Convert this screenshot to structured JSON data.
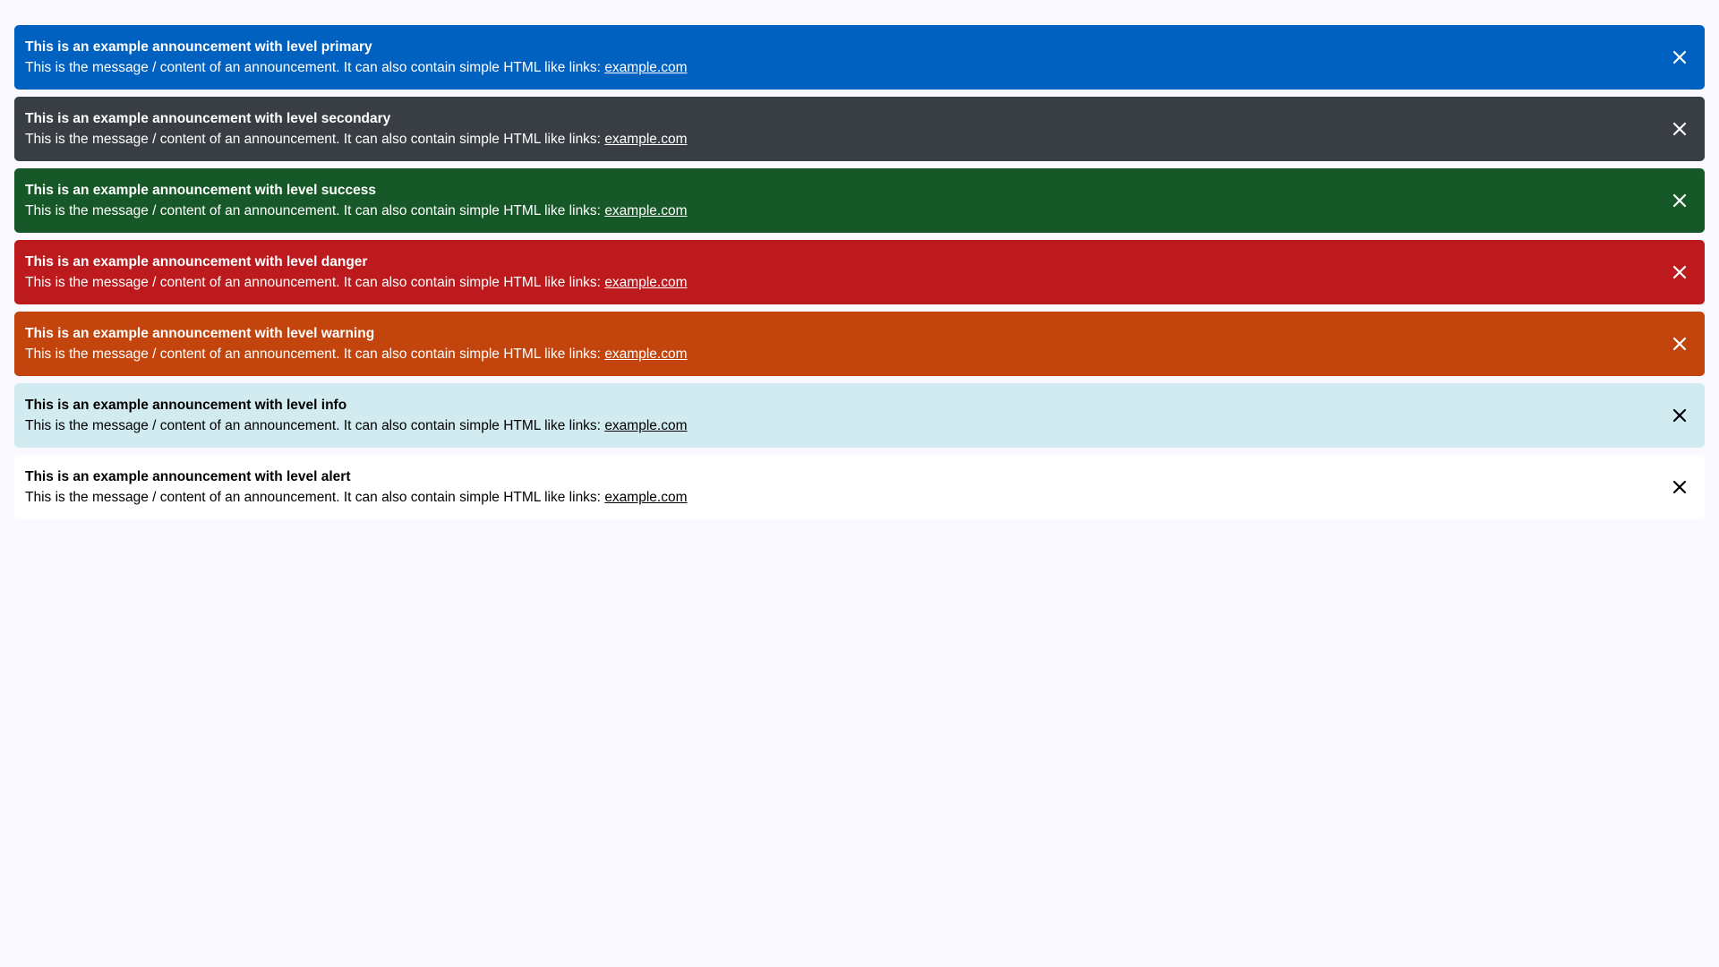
{
  "announcements": [
    {
      "level": "primary",
      "title": "This is an example announcement with level primary",
      "message": "This is the message / content of an announcement. It can also contain simple HTML like links: ",
      "link_text": "example.com",
      "bg": "#0061c1",
      "fg": "#ffffff"
    },
    {
      "level": "secondary",
      "title": "This is an example announcement with level secondary",
      "message": "This is the message / content of an announcement. It can also contain simple HTML like links: ",
      "link_text": "example.com",
      "bg": "#393e45",
      "fg": "#ffffff"
    },
    {
      "level": "success",
      "title": "This is an example announcement with level success",
      "message": "This is the message / content of an announcement. It can also contain simple HTML like links: ",
      "link_text": "example.com",
      "bg": "#165827",
      "fg": "#ffffff"
    },
    {
      "level": "danger",
      "title": "This is an example announcement with level danger",
      "message": "This is the message / content of an announcement. It can also contain simple HTML like links: ",
      "link_text": "example.com",
      "bg": "#bc1a1c",
      "fg": "#ffffff"
    },
    {
      "level": "warning",
      "title": "This is an example announcement with level warning",
      "message": "This is the message / content of an announcement. It can also contain simple HTML like links: ",
      "link_text": "example.com",
      "bg": "#c3440c",
      "fg": "#ffffff"
    },
    {
      "level": "info",
      "title": "This is an example announcement with level info",
      "message": "This is the message / content of an announcement. It can also contain simple HTML like links: ",
      "link_text": "example.com",
      "bg": "#d2ebf0",
      "fg": "#000000"
    },
    {
      "level": "alert",
      "title": "This is an example announcement with level alert",
      "message": "This is the message / content of an announcement. It can also contain simple HTML like links: ",
      "link_text": "example.com",
      "bg": "#ffffff",
      "fg": "#000000"
    }
  ],
  "close_icon": "close-icon",
  "page_background": "#f9f9ff"
}
